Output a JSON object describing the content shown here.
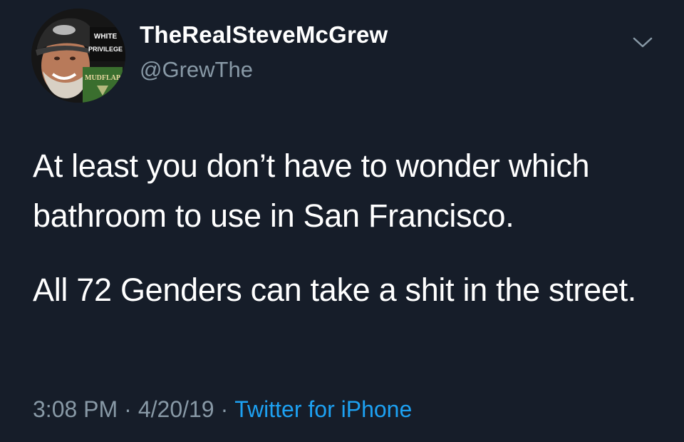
{
  "user": {
    "display_name": "TheRealSteveMcGrew",
    "handle": "@GrewThe",
    "avatar_text": [
      "WHITE",
      "PRIVILEGE",
      "MUDFLAP"
    ]
  },
  "tweet": {
    "paragraphs": [
      "At least you don’t have to wonder which bathroom to use in San Francisco.",
      "All 72 Genders can take a shit in the street."
    ]
  },
  "meta": {
    "time": "3:08 PM",
    "date": "4/20/19",
    "separator": "·",
    "source": "Twitter for iPhone"
  },
  "icons": {
    "menu": "chevron-down-icon"
  },
  "colors": {
    "background": "#161d29",
    "text": "#ffffff",
    "secondary": "#8899a6",
    "link": "#1da1f2"
  }
}
